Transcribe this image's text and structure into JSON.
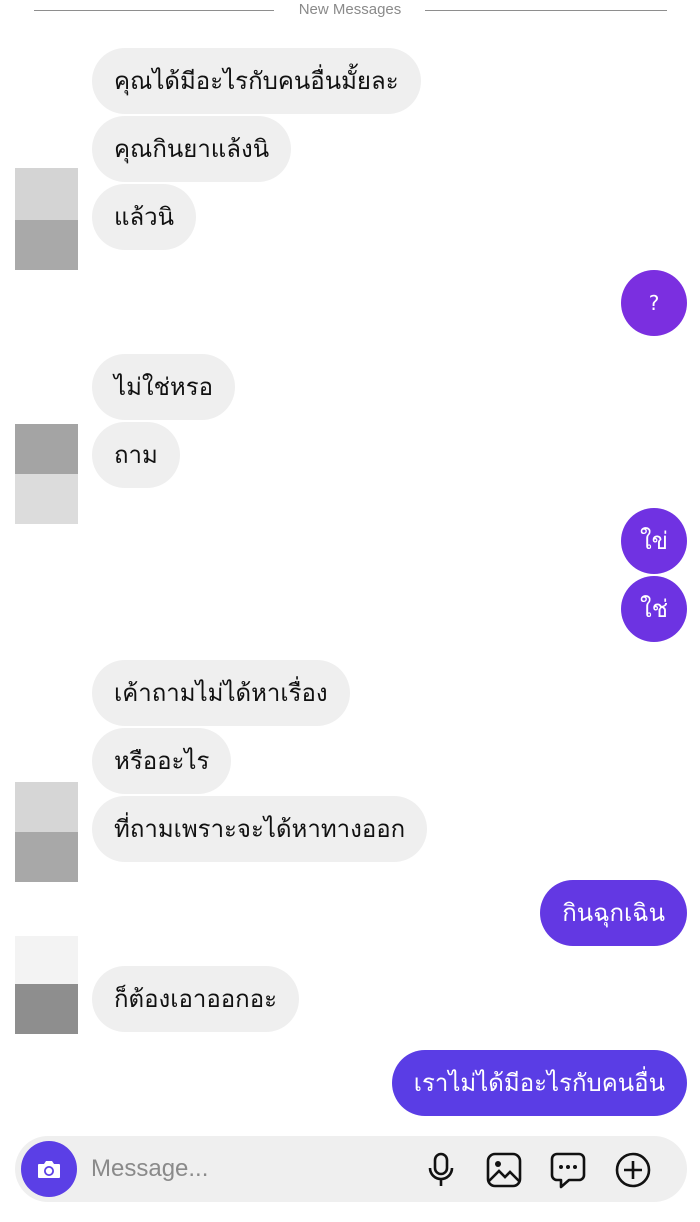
{
  "divider_label": "New Messages",
  "colors": {
    "incoming_bubble": "#efefef",
    "outgoing_purple": "#7b2fe0",
    "outgoing_violet": "#6539e3",
    "composer_bg": "#efefef",
    "camera_button": "#5b3fe6"
  },
  "messages": {
    "m1": "คุณได้มีอะไรกับคนอื่นมั้ยละ",
    "m2": "คุณกินยาแล้งนิ",
    "m3": "แล้วนิ",
    "m4": "?",
    "m5": "ไม่ใช่หรอ",
    "m6": "ถาม",
    "m7": "ใข่",
    "m8": "ใช่",
    "m9": "เค้าถามไม่ได้หาเรื่อง",
    "m10": "หรืออะไร",
    "m11": "ที่ถามเพราะจะได้หาทางออก",
    "m12": "กินฉุกเฉิน",
    "m13": "ก็ต้องเอาออกอะ",
    "m14": "เราไม่ได้มีอะไรกับคนอื่น"
  },
  "composer": {
    "placeholder": "Message...",
    "icons": [
      "camera-icon",
      "microphone-icon",
      "image-icon",
      "sticker-icon",
      "plus-circle-icon"
    ]
  }
}
